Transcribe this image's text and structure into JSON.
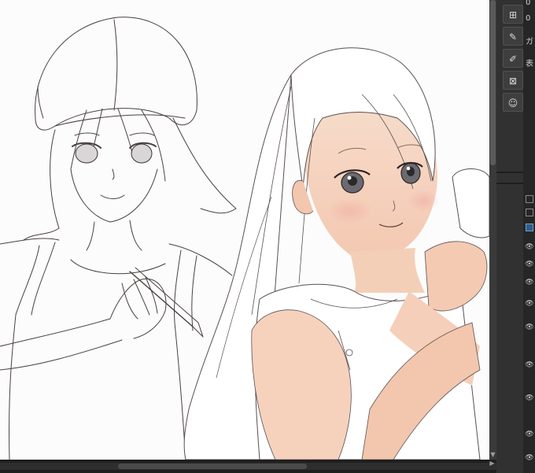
{
  "panel": {
    "tools": [
      {
        "icon": "new-layer-folder-icon"
      },
      {
        "icon": "edit-layer-icon"
      },
      {
        "icon": "edit-layer-alt-icon"
      },
      {
        "icon": "delete-layer-icon"
      },
      {
        "icon": "person-material-icon"
      }
    ],
    "strip_labels": [
      "0",
      "0",
      "ガ",
      "表"
    ]
  },
  "colors": {
    "canvas": "#fcfcfc",
    "panel": "#313131",
    "accent": "#2f5d8c",
    "skin": "#f4cfb8",
    "line": "#4a4040"
  }
}
